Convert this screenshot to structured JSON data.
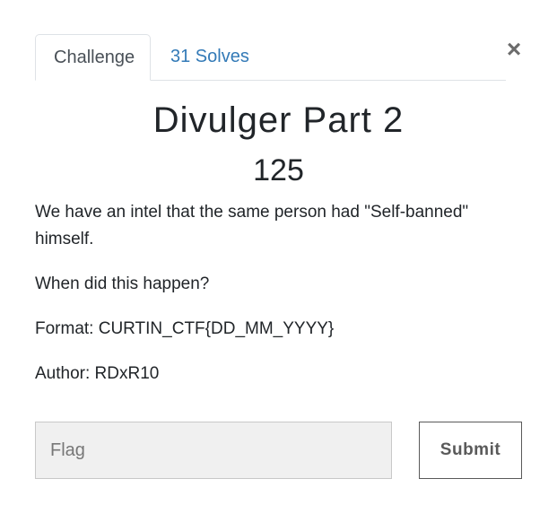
{
  "tabs": {
    "challenge_label": "Challenge",
    "solves_label": "31 Solves"
  },
  "close": {
    "glyph": "×",
    "icon": "close-icon"
  },
  "challenge": {
    "name": "Divulger Part 2",
    "value": "125",
    "description": [
      "We have an intel that the same person had \"Self-banned\" himself.",
      "When did this happen?",
      "Format: CURTIN_CTF{DD_MM_YYYY}",
      "Author: RDxR10"
    ]
  },
  "form": {
    "flag_placeholder": "Flag",
    "flag_value": "",
    "submit_label": "Submit"
  },
  "colors": {
    "link": "#337ab7",
    "text": "#212529",
    "input_bg": "#f0f0f0",
    "button_border": "#5a5a5a"
  }
}
